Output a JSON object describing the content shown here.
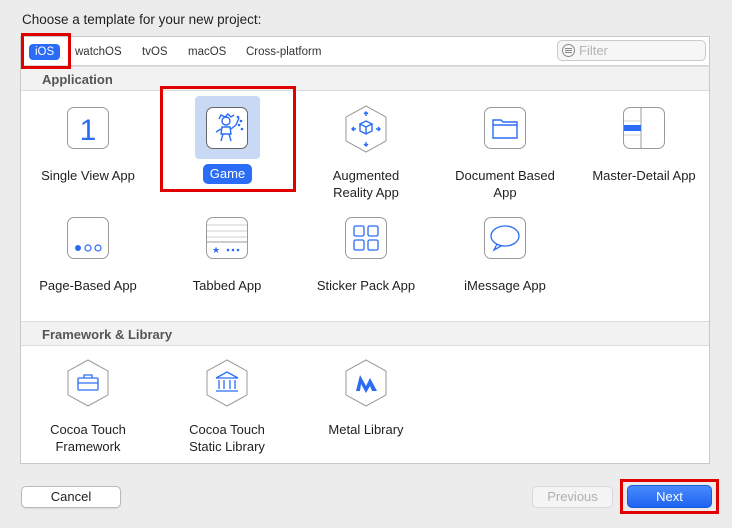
{
  "dialog": {
    "title": "Choose a template for your new project:"
  },
  "platform_tabs": [
    {
      "label": "iOS",
      "selected": true
    },
    {
      "label": "watchOS",
      "selected": false
    },
    {
      "label": "tvOS",
      "selected": false
    },
    {
      "label": "macOS",
      "selected": false
    },
    {
      "label": "Cross-platform",
      "selected": false
    }
  ],
  "filter": {
    "placeholder": "Filter",
    "value": ""
  },
  "sections": {
    "application": {
      "title": "Application",
      "templates": [
        {
          "label": "Single View App",
          "icon": "single-view-app-icon"
        },
        {
          "label": "Game",
          "icon": "game-icon",
          "selected": true
        },
        {
          "label": "Augmented\nReality App",
          "icon": "augmented-reality-icon"
        },
        {
          "label": "Document Based\nApp",
          "icon": "document-folder-icon"
        },
        {
          "label": "Master-Detail App",
          "icon": "master-detail-icon"
        },
        {
          "label": "Page-Based App",
          "icon": "page-based-icon"
        },
        {
          "label": "Tabbed App",
          "icon": "tabbed-icon"
        },
        {
          "label": "Sticker Pack App",
          "icon": "sticker-grid-icon"
        },
        {
          "label": "iMessage App",
          "icon": "speech-bubble-icon"
        }
      ]
    },
    "framework": {
      "title": "Framework & Library",
      "templates": [
        {
          "label": "Cocoa Touch\nFramework",
          "icon": "toolbox-icon"
        },
        {
          "label": "Cocoa Touch\nStatic Library",
          "icon": "library-building-icon"
        },
        {
          "label": "Metal Library",
          "icon": "metal-icon"
        }
      ]
    }
  },
  "buttons": {
    "cancel": "Cancel",
    "previous": "Previous",
    "next": "Next"
  },
  "colors": {
    "accent": "#2b6cf6",
    "highlight": "#c8d9f6",
    "annotation": "#e00000",
    "icon_stroke": "#2b6cf6"
  }
}
